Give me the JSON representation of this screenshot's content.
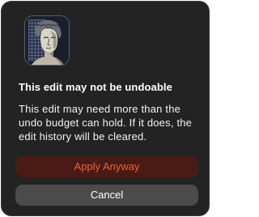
{
  "dialog": {
    "icon": "classical-statue-bust-icon",
    "title": "This edit may not be undoable",
    "message": "This edit may need more than the undo budget can hold. If it does, the edit history will be cleared.",
    "primary_button_label": "Apply Anyway",
    "secondary_button_label": "Cancel"
  },
  "colors": {
    "dialog_background": "#232323",
    "primary_button_background": "#4a1a14",
    "primary_button_text": "#e8603f",
    "secondary_button_background": "#4b4b4b",
    "secondary_button_text": "#ffffff"
  }
}
